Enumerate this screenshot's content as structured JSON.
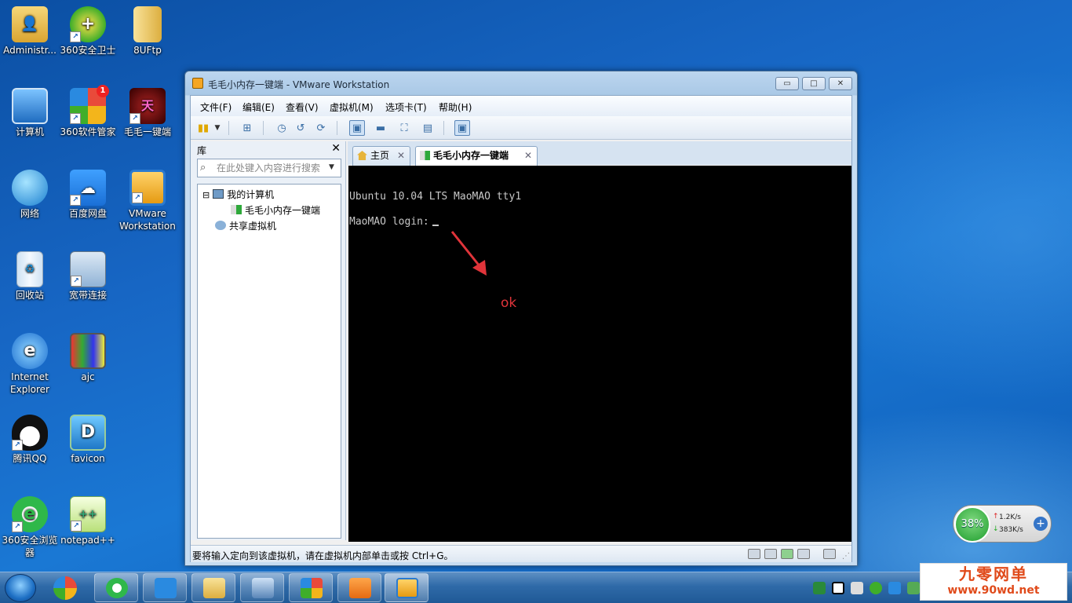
{
  "desktop": {
    "icons": [
      {
        "label": "Administr..."
      },
      {
        "label": "360安全卫士"
      },
      {
        "label": "8UFtp"
      },
      {
        "label": "计算机"
      },
      {
        "label": "360软件管家"
      },
      {
        "label": "毛毛一键端"
      },
      {
        "label": "网络"
      },
      {
        "label": "百度网盘"
      },
      {
        "label": "VMware Workstation"
      },
      {
        "label": "回收站"
      },
      {
        "label": "宽带连接"
      },
      {
        "label": "Internet Explorer"
      },
      {
        "label": "ajc"
      },
      {
        "label": "腾讯QQ"
      },
      {
        "label": "favicon"
      },
      {
        "label": "360安全浏览器"
      },
      {
        "label": "notepad++"
      }
    ],
    "badge_360": "1"
  },
  "window": {
    "title": "毛毛小内存一键端 - VMware Workstation",
    "min_label": "▭",
    "max_label": "□",
    "close_label": "✕"
  },
  "menu": {
    "items": [
      "文件(F)",
      "编辑(E)",
      "查看(V)",
      "虚拟机(M)",
      "选项卡(T)",
      "帮助(H)"
    ]
  },
  "library": {
    "title": "库",
    "close": "✕",
    "search_placeholder": "在此处键入内容进行搜索",
    "tree": {
      "my_computer": "我的计算机",
      "vm": "毛毛小内存一键端",
      "shared": "共享虚拟机"
    },
    "expander": "⊟"
  },
  "tabs": [
    {
      "label": "主页",
      "close": "✕"
    },
    {
      "label": "毛毛小内存一键端",
      "close": "✕"
    }
  ],
  "console": {
    "line1": "Ubuntu 10.04 LTS MaoMAO tty1",
    "line2": "MaoMAO login:",
    "annotation": "ok",
    "annotation_color": "#e0343a"
  },
  "statusbar": {
    "text": "要将输入定向到该虚拟机，请在虚拟机内部单击或按 Ctrl+G。"
  },
  "netmon": {
    "percent": "38%",
    "up": "1.2K/s",
    "down": "383K/s",
    "up_arrow": "↑",
    "down_arrow": "↓",
    "plus": "+"
  },
  "watermark": {
    "line1": "九零网单",
    "line2": "www.90wd.net"
  },
  "colors": {
    "console_bg": "#000000",
    "accent": "#e04a1a"
  }
}
